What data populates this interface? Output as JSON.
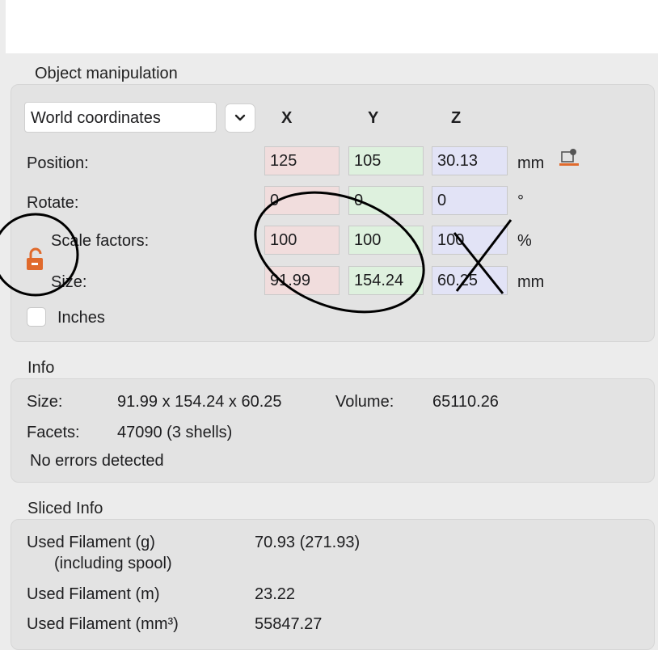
{
  "object_manipulation": {
    "title": "Object manipulation",
    "coordinate_system": "World coordinates",
    "axes": [
      "X",
      "Y",
      "Z"
    ],
    "position": {
      "label": "Position:",
      "x": "125",
      "y": "105",
      "z": "30.13",
      "unit": "mm"
    },
    "rotate": {
      "label": "Rotate:",
      "x": "0",
      "y": "0",
      "z": "0",
      "unit": "°"
    },
    "scale": {
      "label": "Scale factors:",
      "x": "100",
      "y": "100",
      "z": "100",
      "unit": "%"
    },
    "size": {
      "label": "Size:",
      "x": "91.99",
      "y": "154.24",
      "z": "60.25",
      "unit": "mm"
    },
    "inches_label": "Inches",
    "lock_color": "#e06a2c"
  },
  "info": {
    "title": "Info",
    "size_label": "Size:",
    "size_value": "91.99 x 154.24 x 60.25",
    "volume_label": "Volume:",
    "volume_value": "65110.26",
    "facets_label": "Facets:",
    "facets_value": "47090 (3 shells)",
    "errors": "No errors detected"
  },
  "sliced_info": {
    "title": "Sliced Info",
    "rows": [
      {
        "label": "Used Filament (g)",
        "sublabel": "(including spool)",
        "value": "70.93 (271.93)"
      },
      {
        "label": "Used Filament (m)",
        "value": "23.22"
      },
      {
        "label": "Used Filament (mm³)",
        "value": "55847.27"
      }
    ]
  }
}
